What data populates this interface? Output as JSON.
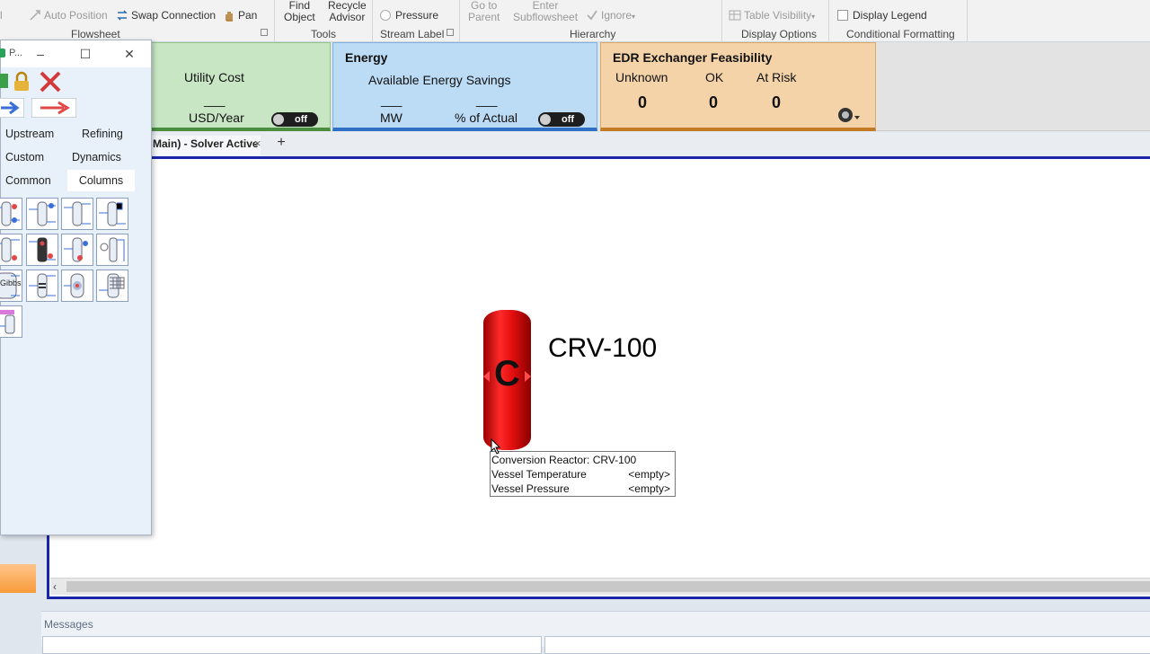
{
  "ribbon": {
    "flowsheet": {
      "auto_position": "Auto Position",
      "swap_connection": "Swap Connection",
      "pan": "Pan",
      "group_label": "Flowsheet"
    },
    "tools": {
      "find_object": [
        "Find",
        "Object"
      ],
      "recycle_advisor": [
        "Recycle",
        "Advisor"
      ],
      "group_label": "Tools"
    },
    "stream_label": {
      "pressure": "Pressure",
      "group_label": "Stream Label"
    },
    "hierarchy": {
      "go_to_parent": [
        "Go to",
        "Parent"
      ],
      "enter_subflowsheet": [
        "Enter",
        "Subflowsheet"
      ],
      "ignore": "Ignore",
      "group_label": "Hierarchy"
    },
    "display_options": {
      "table_visibility": "Table Visibility",
      "group_label": "Display Options"
    },
    "conditional_formatting": {
      "display_legend": "Display Legend",
      "group_label": "Conditional Formatting"
    }
  },
  "kpi": {
    "utility_cost": {
      "label": "Utility Cost",
      "value": "___",
      "unit": "USD/Year",
      "toggle": "off"
    },
    "energy": {
      "title": "Energy",
      "subtitle": "Available Energy Savings",
      "value_mw": "___",
      "value_pct": "___",
      "unit_mw": "MW",
      "unit_pct": "% of Actual",
      "toggle": "off"
    },
    "edr": {
      "title": "EDR Exchanger Feasibility",
      "columns": [
        {
          "label": "Unknown",
          "value": "0"
        },
        {
          "label": "OK",
          "value": "0"
        },
        {
          "label": "At Risk",
          "value": "0"
        }
      ]
    }
  },
  "tabs": {
    "active_tab": "Main) - Solver Active",
    "close": "×",
    "add": "+"
  },
  "flowsheet": {
    "reactor": {
      "letter": "C",
      "name": "CRV-100"
    },
    "tooltip": {
      "title": "Conversion Reactor: CRV-100",
      "rows": [
        {
          "label": "Vessel Temperature",
          "value": "<empty>"
        },
        {
          "label": "Vessel Pressure",
          "value": "<empty>"
        }
      ]
    }
  },
  "palette": {
    "title": "P...",
    "categories": {
      "upstream": "Upstream",
      "refining": "Refining",
      "custom": "Custom",
      "dynamics": "Dynamics",
      "common": "Common",
      "columns": "Columns"
    },
    "gibbs_label": "Gibbs"
  },
  "messages": {
    "label": "Messages"
  },
  "colors": {
    "reactor_red": "#e30f0f",
    "canvas_border": "#1a26a8",
    "utility_green": "#c8e6c4",
    "energy_blue": "#bcdcf5",
    "edr_orange": "#f4d3a9"
  }
}
